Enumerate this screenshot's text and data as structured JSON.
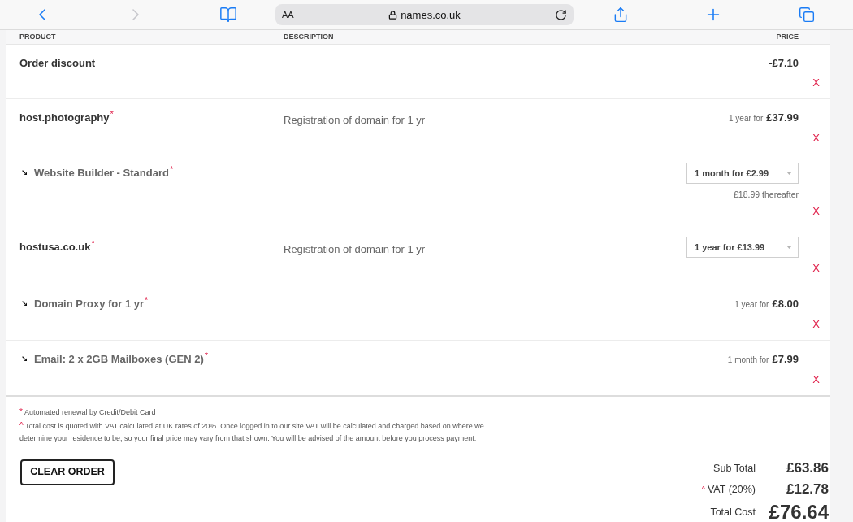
{
  "browser": {
    "nav_buttons": [
      {
        "kind": "back",
        "disabled": false
      },
      {
        "kind": "forward",
        "disabled": true
      }
    ],
    "text_size": "AA",
    "address": "names.co.uk"
  },
  "table": {
    "columns": [
      "PRODUCT",
      "DESCRIPTION",
      "PRICE"
    ],
    "rows": [
      {
        "kind": "item",
        "name": "Order discount",
        "price": {
          "kind": "amount",
          "amount": "-£7.10"
        },
        "remove": "X"
      },
      {
        "kind": "item",
        "name": "host.photography$^{*}$",
        "description": "Registration of domain for 1 yr",
        "price": {
          "kind": "term",
          "term": "1 year for",
          "amount": "£37.99"
        },
        "remove": "X"
      },
      {
        "kind": "sub_item",
        "name": "Website Builder - Standard$^{*}$",
        "price": {
          "kind": "select",
          "value": "1 month for £2.99",
          "note": "£18.99 thereafter"
        },
        "remove": "X"
      },
      {
        "kind": "item",
        "name": "hostusa.co.uk$^{*}$",
        "description": "Registration of domain for 1 yr",
        "price": {
          "kind": "select",
          "value": "1 year for £13.99"
        },
        "remove": "X"
      },
      {
        "kind": "sub_item",
        "name": "Domain Proxy for 1 yr$^{*}$",
        "price": {
          "kind": "term",
          "term": "1 year for",
          "amount": "£8.00"
        },
        "remove": "X"
      },
      {
        "kind": "sub_item",
        "name": "Email: 2 x 2GB Mailboxes (GEN 2)$^{*}$",
        "price": {
          "kind": "term",
          "term": "1 month for",
          "amount": "£7.99"
        },
        "remove": "X"
      }
    ]
  },
  "footnotes": [
    {
      "mark": "*",
      "text": "Automated renewal by Credit/Debit Card"
    },
    {
      "mark": "^",
      "text": "Total cost is quoted with VAT calculated at UK rates of 20%. Once logged in to our site VAT will be calculated and charged based on where we determine your residence to be, so your final price may vary from that shown. You will be advised of the amount before you process payment."
    }
  ],
  "clear_button": "CLEAR ORDER",
  "totals": [
    {
      "kind": "line",
      "label": "Sub Total",
      "amount": "£63.86"
    },
    {
      "kind": "line",
      "mark": "^",
      "label": "VAT (20%)",
      "amount": "£12.78"
    },
    {
      "kind": "grand",
      "label": "Total Cost",
      "amount": "£76.64"
    }
  ]
}
